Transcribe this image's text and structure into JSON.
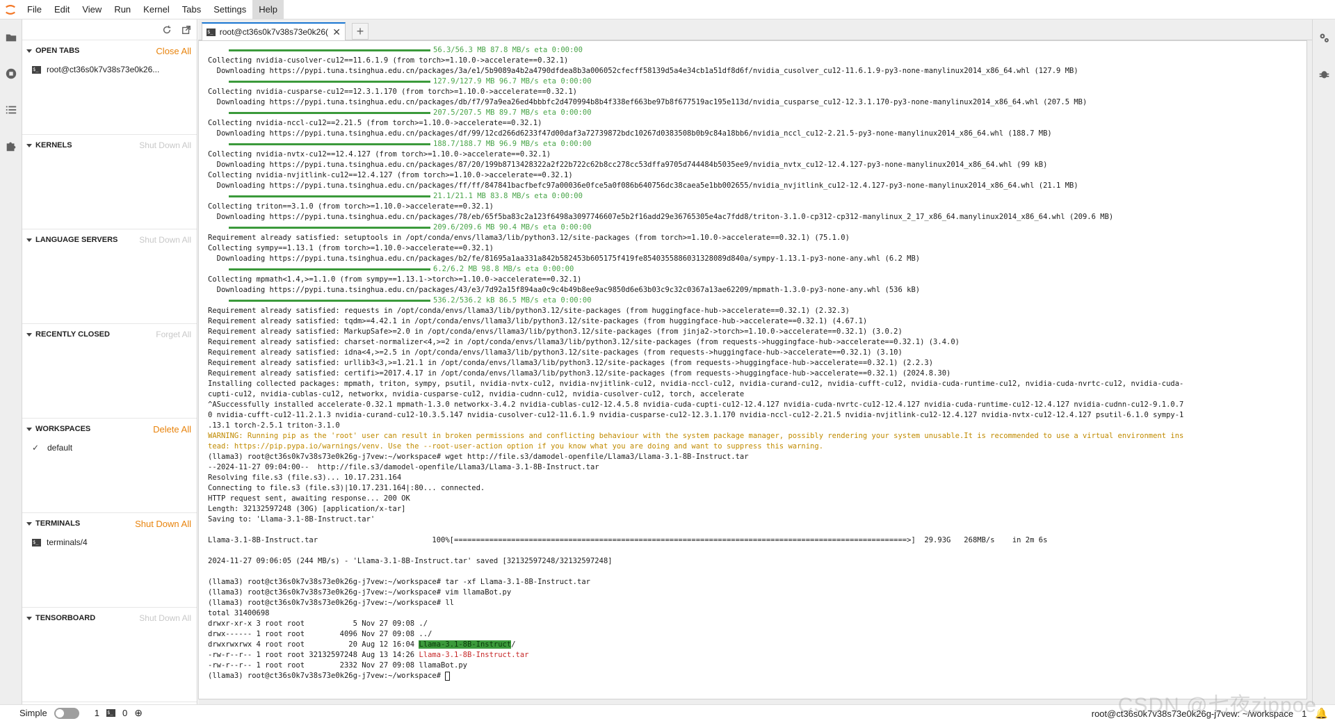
{
  "menubar": {
    "items": [
      "File",
      "Edit",
      "View",
      "Run",
      "Kernel",
      "Tabs",
      "Settings",
      "Help"
    ]
  },
  "sidepanel": {
    "sections": [
      {
        "title": "OPEN TABS",
        "action": "Close All",
        "action_enabled": true,
        "rows": [
          {
            "icon": "terminal-icon",
            "label": "root@ct36s0k7v38s73e0k26..."
          }
        ]
      },
      {
        "title": "KERNELS",
        "action": "Shut Down All",
        "action_enabled": false,
        "rows": []
      },
      {
        "title": "LANGUAGE SERVERS",
        "action": "Shut Down All",
        "action_enabled": false,
        "rows": []
      },
      {
        "title": "RECENTLY CLOSED",
        "action": "Forget All",
        "action_enabled": false,
        "rows": []
      },
      {
        "title": "WORKSPACES",
        "action": "Delete All",
        "action_enabled": true,
        "rows": [
          {
            "icon": "check-icon",
            "label": "default"
          }
        ]
      },
      {
        "title": "TERMINALS",
        "action": "Shut Down All",
        "action_enabled": true,
        "rows": [
          {
            "icon": "terminal-icon",
            "label": "terminals/4"
          }
        ]
      },
      {
        "title": "TENSORBOARD",
        "action": "Shut Down All",
        "action_enabled": false,
        "rows": []
      }
    ]
  },
  "tab": {
    "label": "root@ct36s0k7v38s73e0k26("
  },
  "terminal": {
    "lines": [
      {
        "bar": 290,
        "text": "56.3/56.3 MB 87.8 MB/s eta 0:00:00",
        "cls": "c-green"
      },
      {
        "text": "Collecting nvidia-cusolver-cu12==11.6.1.9 (from torch>=1.10.0->accelerate==0.32.1)"
      },
      {
        "text": "  Downloading https://pypi.tuna.tsinghua.edu.cn/packages/3a/e1/5b9089a4b2a4790dfdea8b3a006052cfecff58139d5a4e34cb1a51df8d6f/nvidia_cusolver_cu12-11.6.1.9-py3-none-manylinux2014_x86_64.whl (127.9 MB)"
      },
      {
        "bar": 290,
        "text": "127.9/127.9 MB 96.7 MB/s eta 0:00:00",
        "cls": "c-green"
      },
      {
        "text": "Collecting nvidia-cusparse-cu12==12.3.1.170 (from torch>=1.10.0->accelerate==0.32.1)"
      },
      {
        "text": "  Downloading https://pypi.tuna.tsinghua.edu.cn/packages/db/f7/97a9ea26ed4bbbfc2d470994b8b4f338ef663be97b8f677519ac195e113d/nvidia_cusparse_cu12-12.3.1.170-py3-none-manylinux2014_x86_64.whl (207.5 MB)"
      },
      {
        "bar": 290,
        "text": "207.5/207.5 MB 89.7 MB/s eta 0:00:00",
        "cls": "c-green"
      },
      {
        "text": "Collecting nvidia-nccl-cu12==2.21.5 (from torch>=1.10.0->accelerate==0.32.1)"
      },
      {
        "text": "  Downloading https://pypi.tuna.tsinghua.edu.cn/packages/df/99/12cd266d6233f47d00daf3a72739872bdc10267d0383508b0b9c84a18bb6/nvidia_nccl_cu12-2.21.5-py3-none-manylinux2014_x86_64.whl (188.7 MB)"
      },
      {
        "bar": 290,
        "text": "188.7/188.7 MB 96.9 MB/s eta 0:00:00",
        "cls": "c-green"
      },
      {
        "text": "Collecting nvidia-nvtx-cu12==12.4.127 (from torch>=1.10.0->accelerate==0.32.1)"
      },
      {
        "text": "  Downloading https://pypi.tuna.tsinghua.edu.cn/packages/87/20/199b8713428322a2f22b722c62b8cc278cc53dffa9705d744484b5035ee9/nvidia_nvtx_cu12-12.4.127-py3-none-manylinux2014_x86_64.whl (99 kB)"
      },
      {
        "text": "Collecting nvidia-nvjitlink-cu12==12.4.127 (from torch>=1.10.0->accelerate==0.32.1)"
      },
      {
        "text": "  Downloading https://pypi.tuna.tsinghua.edu.cn/packages/ff/ff/847841bacfbefc97a00036e0fce5a0f086b640756dc38caea5e1bb002655/nvidia_nvjitlink_cu12-12.4.127-py3-none-manylinux2014_x86_64.whl (21.1 MB)"
      },
      {
        "bar": 290,
        "text": "21.1/21.1 MB 83.8 MB/s eta 0:00:00",
        "cls": "c-green"
      },
      {
        "text": "Collecting triton==3.1.0 (from torch>=1.10.0->accelerate==0.32.1)"
      },
      {
        "text": "  Downloading https://pypi.tuna.tsinghua.edu.cn/packages/78/eb/65f5ba83c2a123f6498a3097746607e5b2f16add29e36765305e4ac7fdd8/triton-3.1.0-cp312-cp312-manylinux_2_17_x86_64.manylinux2014_x86_64.whl (209.6 MB)"
      },
      {
        "bar": 290,
        "text": "209.6/209.6 MB 90.4 MB/s eta 0:00:00",
        "cls": "c-green"
      },
      {
        "text": "Requirement already satisfied: setuptools in /opt/conda/envs/llama3/lib/python3.12/site-packages (from torch>=1.10.0->accelerate==0.32.1) (75.1.0)"
      },
      {
        "text": "Collecting sympy==1.13.1 (from torch>=1.10.0->accelerate==0.32.1)"
      },
      {
        "text": "  Downloading https://pypi.tuna.tsinghua.edu.cn/packages/b2/fe/81695a1aa331a842b582453b605175f419fe8540355886031328089d840a/sympy-1.13.1-py3-none-any.whl (6.2 MB)"
      },
      {
        "bar": 290,
        "text": "6.2/6.2 MB 98.8 MB/s eta 0:00:00",
        "cls": "c-green"
      },
      {
        "text": "Collecting mpmath<1.4,>=1.1.0 (from sympy==1.13.1->torch>=1.10.0->accelerate==0.32.1)"
      },
      {
        "text": "  Downloading https://pypi.tuna.tsinghua.edu.cn/packages/43/e3/7d92a15f894aa0c9c4b49b8ee9ac9850d6e63b03c9c32c0367a13ae62209/mpmath-1.3.0-py3-none-any.whl (536 kB)"
      },
      {
        "bar": 290,
        "text": "536.2/536.2 kB 86.5 MB/s eta 0:00:00",
        "cls": "c-green"
      },
      {
        "text": "Requirement already satisfied: requests in /opt/conda/envs/llama3/lib/python3.12/site-packages (from huggingface-hub->accelerate==0.32.1) (2.32.3)"
      },
      {
        "text": "Requirement already satisfied: tqdm>=4.42.1 in /opt/conda/envs/llama3/lib/python3.12/site-packages (from huggingface-hub->accelerate==0.32.1) (4.67.1)"
      },
      {
        "text": "Requirement already satisfied: MarkupSafe>=2.0 in /opt/conda/envs/llama3/lib/python3.12/site-packages (from jinja2->torch>=1.10.0->accelerate==0.32.1) (3.0.2)"
      },
      {
        "text": "Requirement already satisfied: charset-normalizer<4,>=2 in /opt/conda/envs/llama3/lib/python3.12/site-packages (from requests->huggingface-hub->accelerate==0.32.1) (3.4.0)"
      },
      {
        "text": "Requirement already satisfied: idna<4,>=2.5 in /opt/conda/envs/llama3/lib/python3.12/site-packages (from requests->huggingface-hub->accelerate==0.32.1) (3.10)"
      },
      {
        "text": "Requirement already satisfied: urllib3<3,>=1.21.1 in /opt/conda/envs/llama3/lib/python3.12/site-packages (from requests->huggingface-hub->accelerate==0.32.1) (2.2.3)"
      },
      {
        "text": "Requirement already satisfied: certifi>=2017.4.17 in /opt/conda/envs/llama3/lib/python3.12/site-packages (from requests->huggingface-hub->accelerate==0.32.1) (2024.8.30)"
      },
      {
        "text": "Installing collected packages: mpmath, triton, sympy, psutil, nvidia-nvtx-cu12, nvidia-nvjitlink-cu12, nvidia-nccl-cu12, nvidia-curand-cu12, nvidia-cufft-cu12, nvidia-cuda-runtime-cu12, nvidia-cuda-nvrtc-cu12, nvidia-cuda-"
      },
      {
        "text": "cupti-cu12, nvidia-cublas-cu12, networkx, nvidia-cusparse-cu12, nvidia-cudnn-cu12, nvidia-cusolver-cu12, torch, accelerate"
      },
      {
        "text": "^ASuccessfully installed accelerate-0.32.1 mpmath-1.3.0 networkx-3.4.2 nvidia-cublas-cu12-12.4.5.8 nvidia-cuda-cupti-cu12-12.4.127 nvidia-cuda-nvrtc-cu12-12.4.127 nvidia-cuda-runtime-cu12-12.4.127 nvidia-cudnn-cu12-9.1.0.7"
      },
      {
        "text": "0 nvidia-cufft-cu12-11.2.1.3 nvidia-curand-cu12-10.3.5.147 nvidia-cusolver-cu12-11.6.1.9 nvidia-cusparse-cu12-12.3.1.170 nvidia-nccl-cu12-2.21.5 nvidia-nvjitlink-cu12-12.4.127 nvidia-nvtx-cu12-12.4.127 psutil-6.1.0 sympy-1"
      },
      {
        "text": ".13.1 torch-2.5.1 triton-3.1.0"
      },
      {
        "text": "WARNING: Running pip as the 'root' user can result in broken permissions and conflicting behaviour with the system package manager, possibly rendering your system unusable.It is recommended to use a virtual environment ins",
        "cls": "c-warn"
      },
      {
        "text": "tead: https://pip.pypa.io/warnings/venv. Use the --root-user-action option if you know what you are doing and want to suppress this warning.",
        "cls": "c-warn"
      },
      {
        "text": "(llama3) root@ct36s0k7v38s73e0k26g-j7vew:~/workspace# wget http://file.s3/damodel-openfile/Llama3/Llama-3.1-8B-Instruct.tar"
      },
      {
        "text": "--2024-11-27 09:04:00--  http://file.s3/damodel-openfile/Llama3/Llama-3.1-8B-Instruct.tar"
      },
      {
        "text": "Resolving file.s3 (file.s3)... 10.17.231.164"
      },
      {
        "text": "Connecting to file.s3 (file.s3)|10.17.231.164|:80... connected."
      },
      {
        "text": "HTTP request sent, awaiting response... 200 OK"
      },
      {
        "text": "Length: 32132597248 (30G) [application/x-tar]"
      },
      {
        "text": "Saving to: 'Llama-3.1-8B-Instruct.tar'"
      },
      {
        "text": ""
      },
      {
        "text": "Llama-3.1-8B-Instruct.tar                          100%[=======================================================================================================>]  29.93G   268MB/s    in 2m 6s"
      },
      {
        "text": ""
      },
      {
        "text": "2024-11-27 09:06:05 (244 MB/s) - 'Llama-3.1-8B-Instruct.tar' saved [32132597248/32132597248]"
      },
      {
        "text": ""
      },
      {
        "text": "(llama3) root@ct36s0k7v38s73e0k26g-j7vew:~/workspace# tar -xf Llama-3.1-8B-Instruct.tar"
      },
      {
        "text": "(llama3) root@ct36s0k7v38s73e0k26g-j7vew:~/workspace# vim llamaBot.py"
      },
      {
        "text": "(llama3) root@ct36s0k7v38s73e0k26g-j7vew:~/workspace# ll"
      },
      {
        "text": "total 31400698"
      },
      {
        "text": "drwxr-xr-x 3 root root           5 Nov 27 09:08 ./"
      },
      {
        "text": "drwx------ 1 root root        4096 Nov 27 09:08 ../"
      },
      {
        "text": "drwxrwxrwx 4 root root          20 Aug 12 16:04 ",
        "dir": "Llama-3.1-8B-Instruct",
        "tail": "/"
      },
      {
        "text": "-rw-r--r-- 1 root root 32132597248 Aug 13 14:26 ",
        "red": "Llama-3.1-8B-Instruct.tar"
      },
      {
        "text": "-rw-r--r-- 1 root root        2332 Nov 27 09:08 llamaBot.py"
      },
      {
        "text": "(llama3) root@ct36s0k7v38s73e0k26g-j7vew:~/workspace# ",
        "cursor": true
      }
    ]
  },
  "statusbar": {
    "mode_label": "Simple",
    "count_1": "1",
    "count_2": "0",
    "terminal_path": "root@ct36s0k7v38s73e0k26g-j7vew: ~/workspace",
    "notifications": "1",
    "watermark": "CSDN @七夜zippoe"
  }
}
